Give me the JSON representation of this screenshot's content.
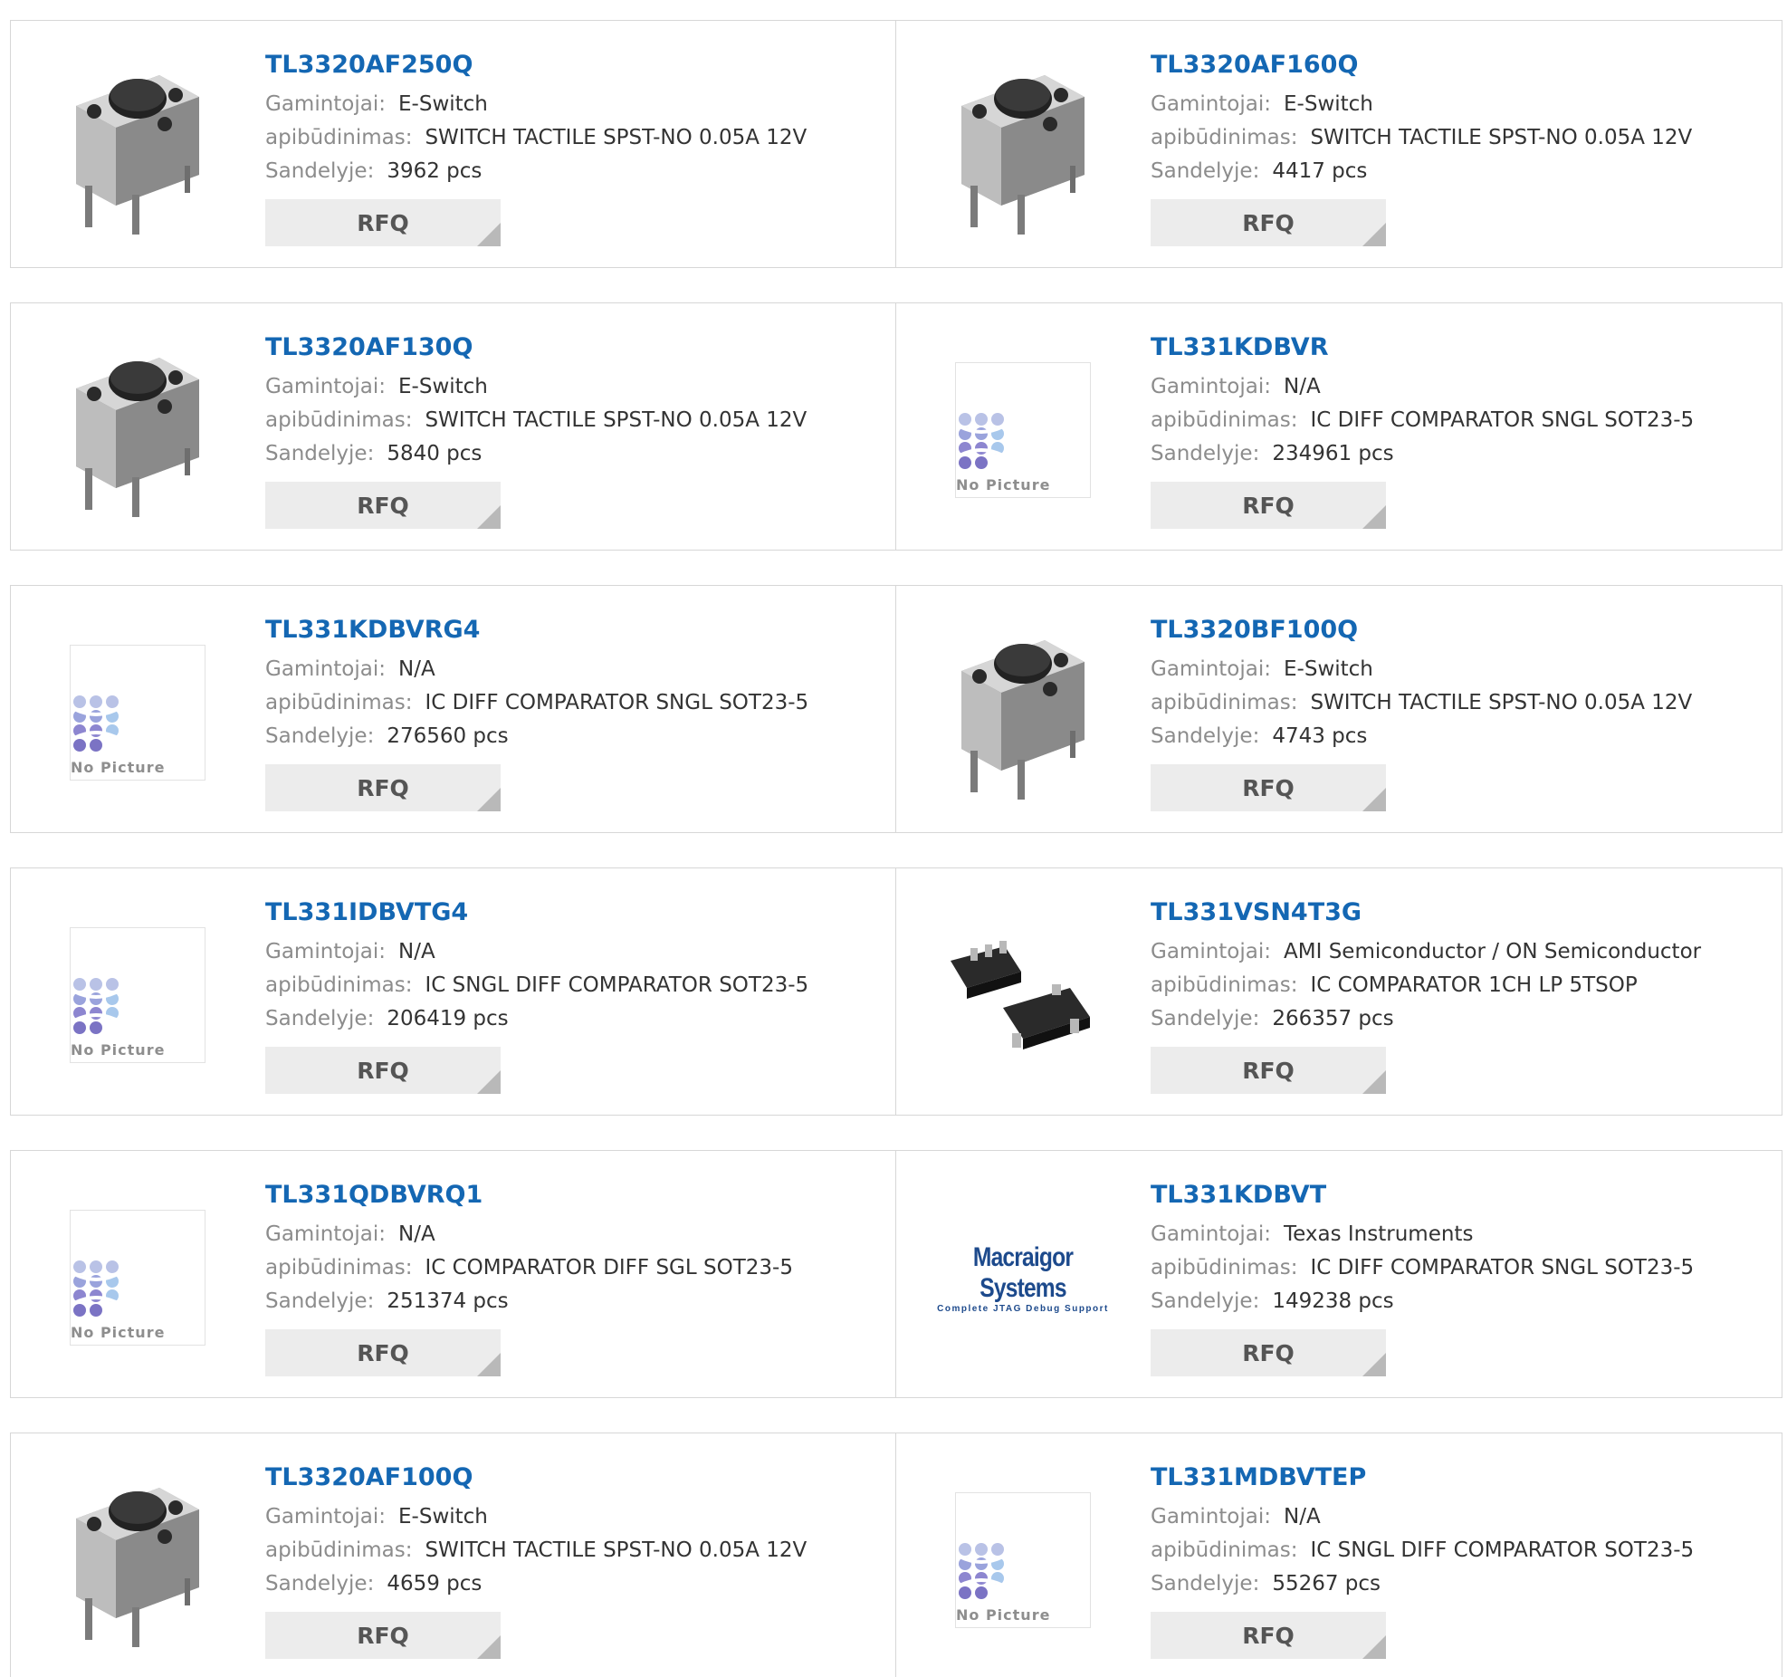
{
  "labels": {
    "manufacturer": "Gamintojai:",
    "description": "apibūdinimas:",
    "stock": "Sandelyje:",
    "rfq": "RFQ",
    "no_picture": "No Picture"
  },
  "products": [
    {
      "part": "TL3320AF250Q",
      "manufacturer": "E-Switch",
      "description": "SWITCH TACTILE SPST-NO 0.05A 12V",
      "stock": "3962 pcs",
      "image": "tactile-switch"
    },
    {
      "part": "TL3320AF160Q",
      "manufacturer": "E-Switch",
      "description": "SWITCH TACTILE SPST-NO 0.05A 12V",
      "stock": "4417 pcs",
      "image": "tactile-switch"
    },
    {
      "part": "TL3320AF130Q",
      "manufacturer": "E-Switch",
      "description": "SWITCH TACTILE SPST-NO 0.05A 12V",
      "stock": "5840 pcs",
      "image": "tactile-switch"
    },
    {
      "part": "TL331KDBVR",
      "manufacturer": "N/A",
      "description": "IC DIFF COMPARATOR SNGL SOT23-5",
      "stock": "234961 pcs",
      "image": "no-picture"
    },
    {
      "part": "TL331KDBVRG4",
      "manufacturer": "N/A",
      "description": "IC DIFF COMPARATOR SNGL SOT23-5",
      "stock": "276560 pcs",
      "image": "no-picture"
    },
    {
      "part": "TL3320BF100Q",
      "manufacturer": "E-Switch",
      "description": "SWITCH TACTILE SPST-NO 0.05A 12V",
      "stock": "4743 pcs",
      "image": "tactile-switch"
    },
    {
      "part": "TL331IDBVTG4",
      "manufacturer": "N/A",
      "description": "IC SNGL DIFF COMPARATOR SOT23-5",
      "stock": "206419 pcs",
      "image": "no-picture"
    },
    {
      "part": "TL331VSN4T3G",
      "manufacturer": "AMI Semiconductor / ON Semiconductor",
      "description": "IC COMPARATOR 1CH LP 5TSOP",
      "stock": "266357 pcs",
      "image": "ic-chip"
    },
    {
      "part": "TL331QDBVRQ1",
      "manufacturer": "N/A",
      "description": "IC COMPARATOR DIFF SGL SOT23-5",
      "stock": "251374 pcs",
      "image": "no-picture"
    },
    {
      "part": "TL331KDBVT",
      "manufacturer": "Texas Instruments",
      "description": "IC DIFF COMPARATOR SNGL SOT23-5",
      "stock": "149238 pcs",
      "image": "brand-logo",
      "logo_text": "Macraigor Systems",
      "logo_tagline": "Complete JTAG Debug Support"
    },
    {
      "part": "TL3320AF100Q",
      "manufacturer": "E-Switch",
      "description": "SWITCH TACTILE SPST-NO 0.05A 12V",
      "stock": "4659 pcs",
      "image": "tactile-switch"
    },
    {
      "part": "TL331MDBVTEP",
      "manufacturer": "N/A",
      "description": "IC SNGL DIFF COMPARATOR SOT23-5",
      "stock": "55267 pcs",
      "image": "no-picture"
    }
  ]
}
